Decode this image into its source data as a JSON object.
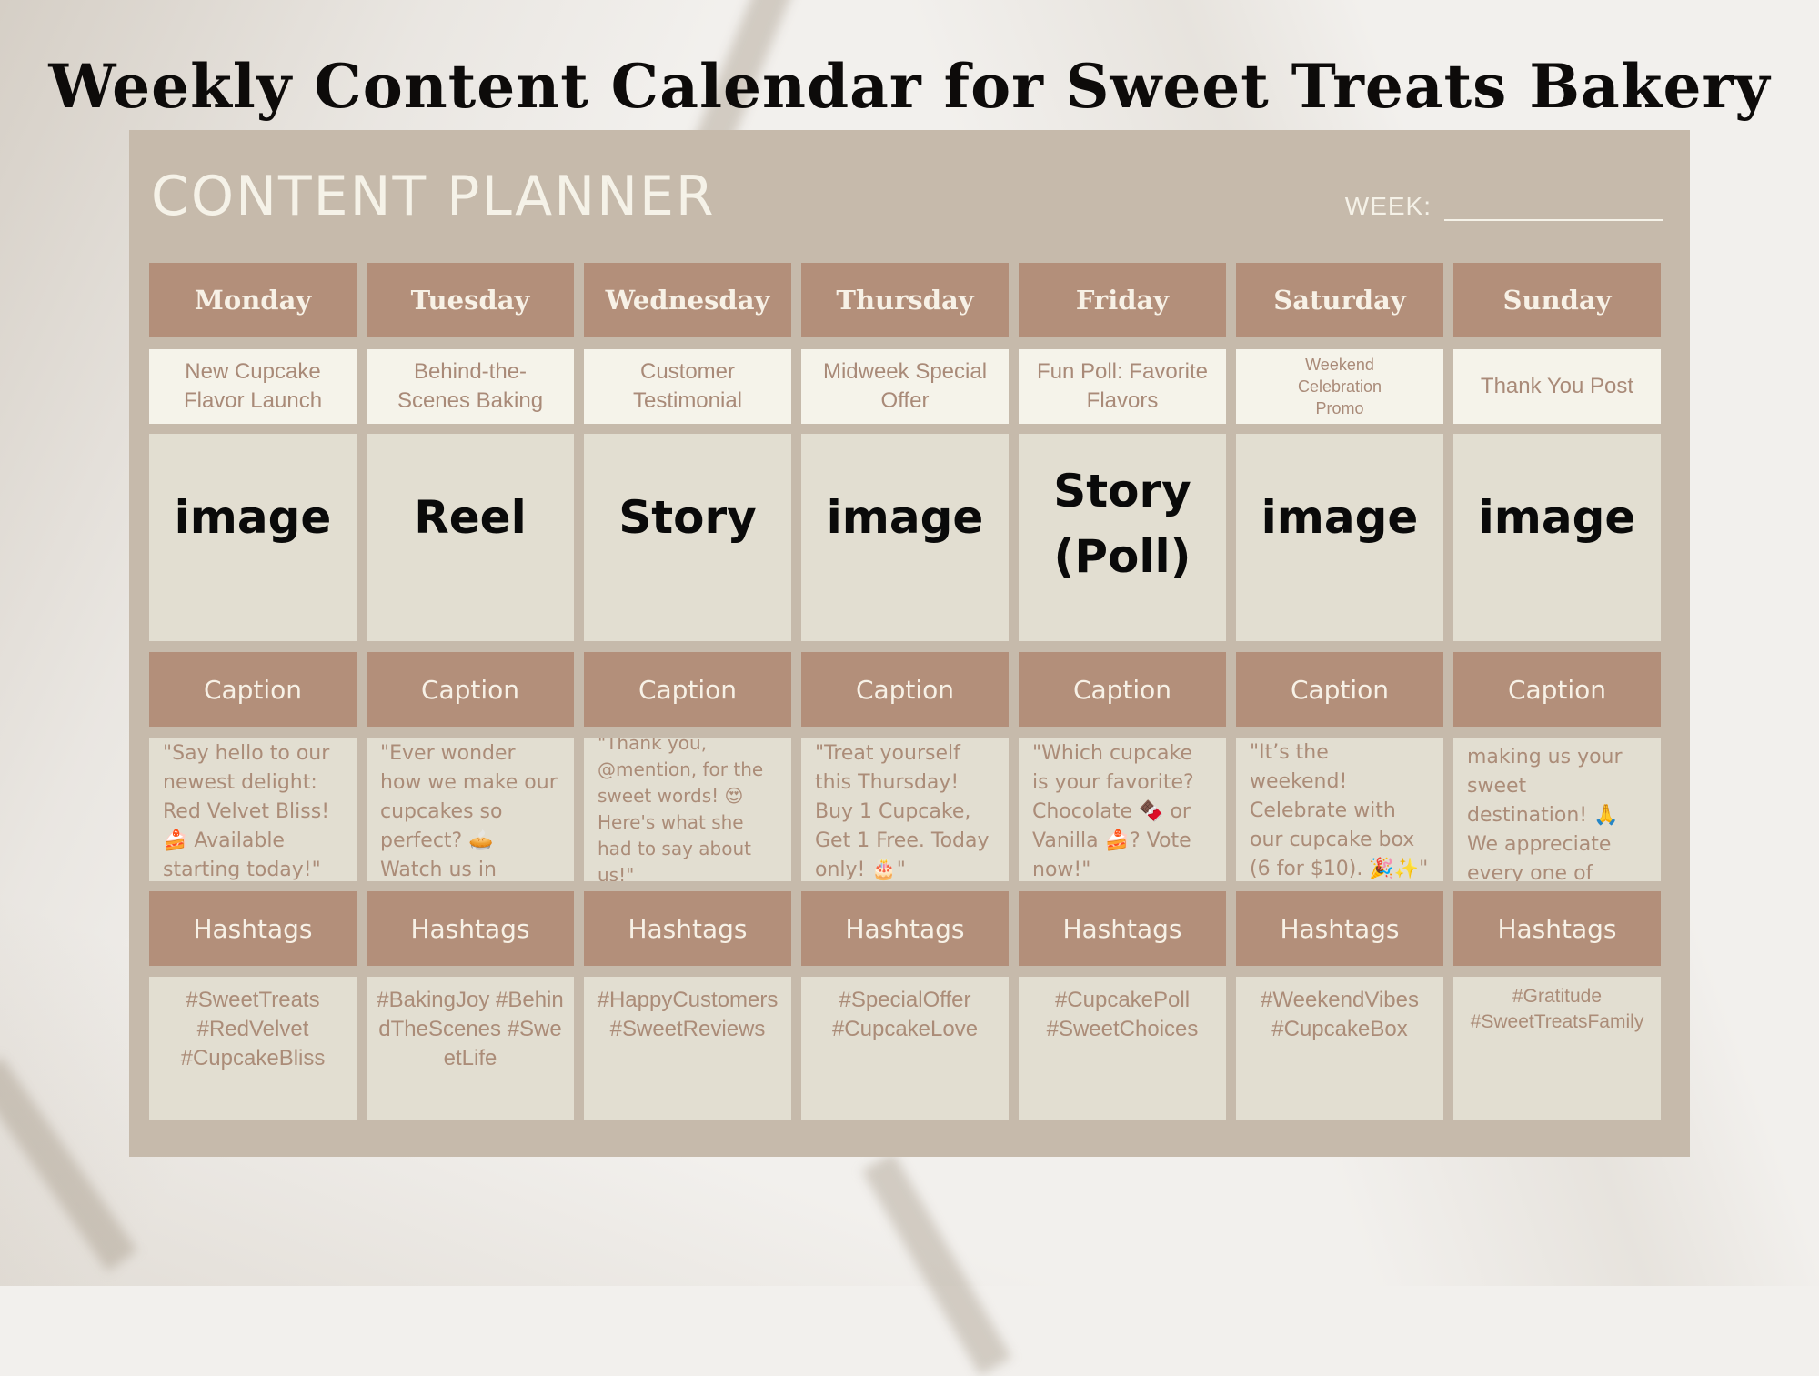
{
  "page_title": "Weekly Content Calendar for Sweet Treats Bakery",
  "planner": {
    "title": "CONTENT PLANNER",
    "week_label": "WEEK:",
    "week_value": ""
  },
  "section_labels": {
    "caption": "Caption",
    "hashtags": "Hashtags"
  },
  "colors": {
    "panel": "#c6baab",
    "header_fill": "#b38f7a",
    "topic_fill": "#f5f3ea",
    "cell_fill": "#e2ded1",
    "body_text": "#ab8c78",
    "header_text": "#f7f1e6"
  },
  "days": [
    {
      "day": "Monday",
      "topic": "New Cupcake Flavor Launch",
      "format": "image",
      "caption": "\"Say hello to our newest delight: Red Velvet Bliss! 🍰 Available starting today!\"",
      "hashtags": "#SweetTreats #RedVelvet #CupcakeBliss"
    },
    {
      "day": "Tuesday",
      "topic": "Behind-the-Scenes Baking",
      "format": "Reel",
      "caption": "\"Ever wonder how we make our cupcakes so perfect? 🥧 Watch us in action!\"",
      "hashtags": "#BakingJoy #BehindTheScenes #SweetLife"
    },
    {
      "day": "Wednesday",
      "topic": "Customer Testimonial",
      "format": "Story",
      "caption": "\"Thank you, @mention, for the sweet words! 😍 Here's what she had to say about us!\"",
      "hashtags": "#HappyCustomers #SweetReviews"
    },
    {
      "day": "Thursday",
      "topic": "Midweek Special Offer",
      "format": "image",
      "caption": "\"Treat yourself this Thursday! Buy 1 Cupcake, Get 1 Free. Today only! 🎂\"",
      "hashtags": "#SpecialOffer #CupcakeLove"
    },
    {
      "day": "Friday",
      "topic": "Fun Poll: Favorite Flavors",
      "format": "Story (Poll)",
      "caption": "\"Which cupcake is your favorite? Chocolate 🍫 or Vanilla 🍰? Vote now!\"",
      "hashtags": "#CupcakePoll #SweetChoices"
    },
    {
      "day": "Saturday",
      "topic": "Weekend Celebration Promo",
      "format": "image",
      "caption": "\"It’s the weekend! Celebrate with our cupcake box (6 for $10). 🎉✨\"",
      "hashtags": "#WeekendVibes #CupcakeBox"
    },
    {
      "day": "Sunday",
      "topic": "Thank You Post",
      "format": "image",
      "caption": "\"Thank you for making us your sweet destination! 🙏 We appreciate every one of you.\"",
      "hashtags": "#Gratitude #SweetTreatsFamily"
    }
  ]
}
